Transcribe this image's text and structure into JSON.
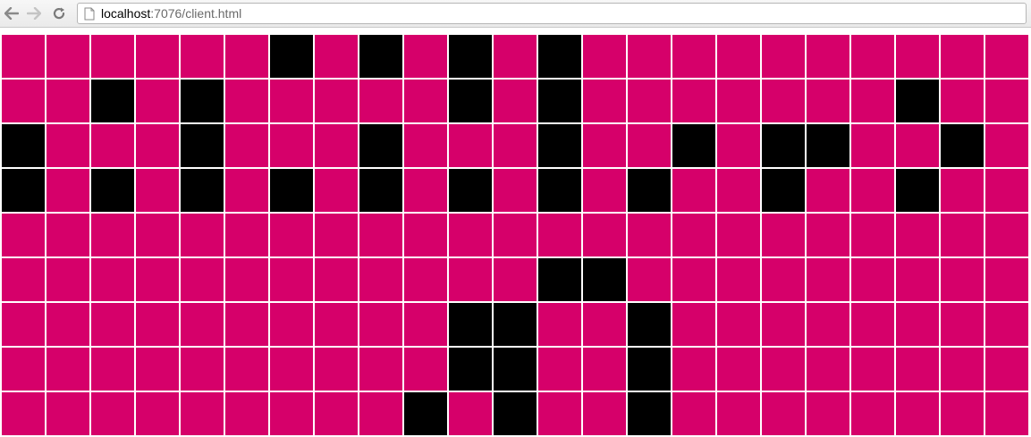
{
  "browser": {
    "url_host": "localhost",
    "url_path": ":7076/client.html",
    "back_icon": "back-arrow-icon",
    "forward_icon": "forward-arrow-icon",
    "reload_icon": "reload-icon",
    "page_icon": "document-icon"
  },
  "colors": {
    "on": "#000000",
    "off": "#d6006a"
  },
  "grid": {
    "rows": [
      "......#.#.#.#..........",
      "..#.#.....#.#.......#..",
      "#...#...#...#..#.##..#.",
      "#.#.#.#.#.#.#.#..#..#..",
      ".......................",
      "............##.........",
      "..........##..#........",
      "..........##..#........",
      ".........#.#..#........"
    ]
  }
}
